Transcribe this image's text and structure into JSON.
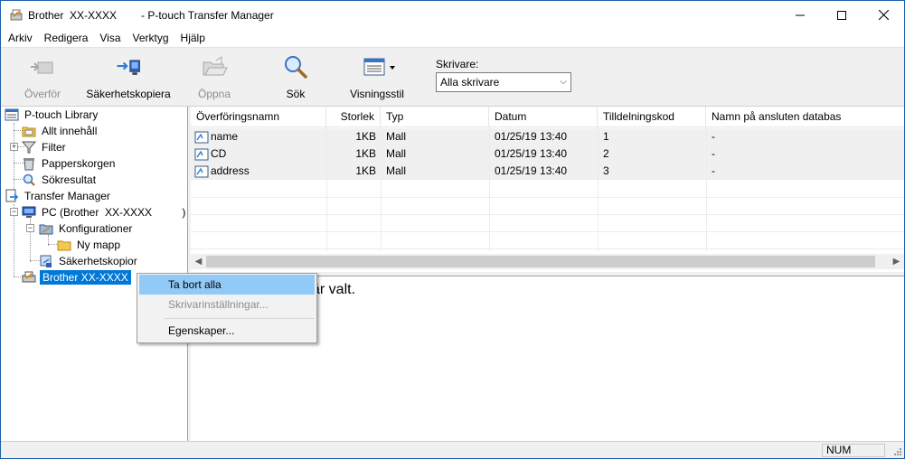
{
  "window": {
    "title_device": "Brother  XX-XXXX",
    "title_app": "- P-touch Transfer Manager"
  },
  "menu": [
    "Arkiv",
    "Redigera",
    "Visa",
    "Verktyg",
    "Hjälp"
  ],
  "toolbar": {
    "transfer": "Överför",
    "backup": "Säkerhetskopiera",
    "open": "Öppna",
    "search": "Sök",
    "view_style": "Visningsstil",
    "printer_label": "Skrivare:",
    "printer_value": "Alla skrivare"
  },
  "tree": {
    "library": "P-touch Library",
    "all_contents": "Allt innehåll",
    "filter": "Filter",
    "trash": "Papperskorgen",
    "search_results": "Sökresultat",
    "transfer_manager": "Transfer Manager",
    "pc": "PC (Brother  XX-XXXX          )",
    "configurations": "Konfigurationer",
    "new_folder": "Ny mapp",
    "backups": "Säkerhetskopior",
    "device": "Brother  XX-XXXX"
  },
  "list": {
    "columns": [
      "Överföringsnamn",
      "Storlek",
      "Typ",
      "Datum",
      "Tilldelningskod",
      "Namn på ansluten databas"
    ],
    "rows": [
      {
        "name": "name",
        "size": "1KB",
        "type": "Mall",
        "date": "01/25/19 13:40",
        "code": "1",
        "db": "-"
      },
      {
        "name": "CD",
        "size": "1KB",
        "type": "Mall",
        "date": "01/25/19 13:40",
        "code": "2",
        "db": "-"
      },
      {
        "name": "address",
        "size": "1KB",
        "type": "Mall",
        "date": "01/25/19 13:40",
        "code": "3",
        "db": "-"
      }
    ]
  },
  "preview": {
    "text": "är valt."
  },
  "status": {
    "num": "NUM"
  },
  "context_menu": {
    "delete_all": "Ta bort alla",
    "printer_settings": "Skrivarinställningar...",
    "properties": "Egenskaper..."
  },
  "colors": {
    "selection": "#0078d7",
    "menu_highlight": "#91c9f7",
    "chrome": "#f0f0f0"
  }
}
